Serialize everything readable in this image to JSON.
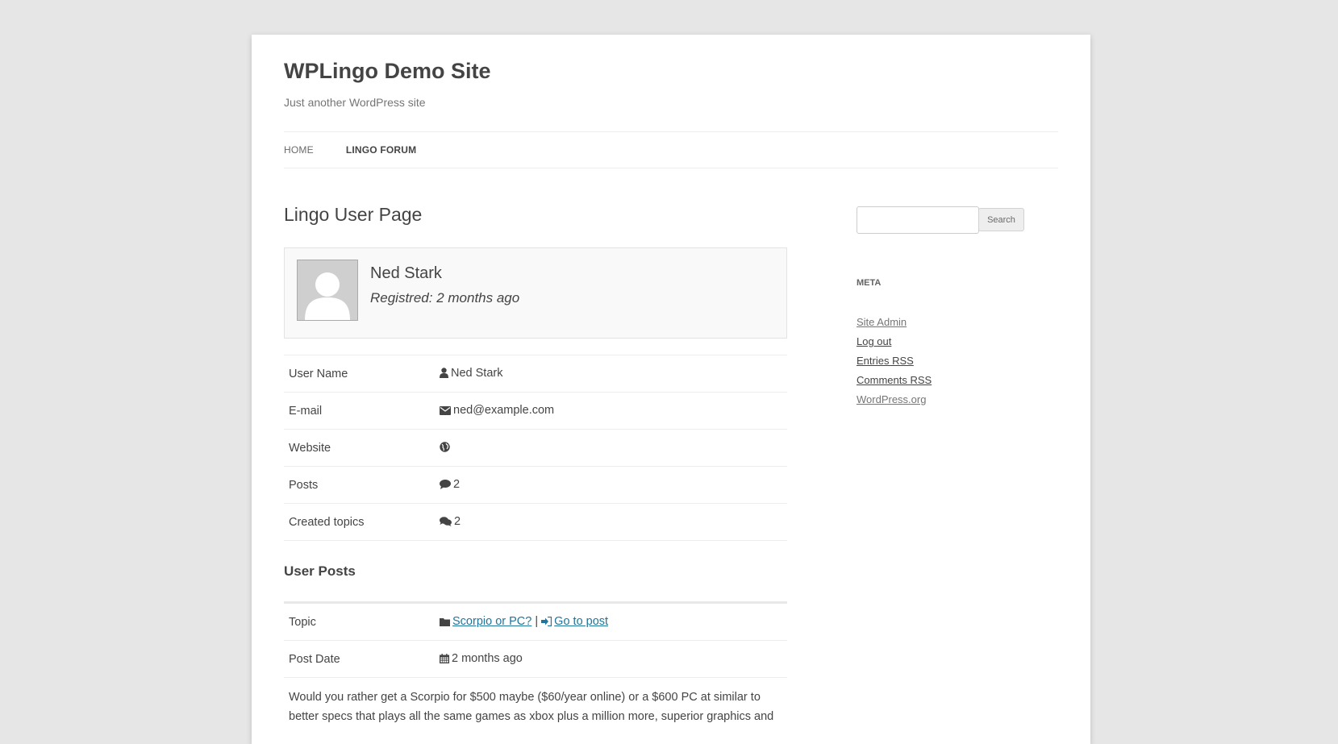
{
  "site": {
    "title": "WPLingo Demo Site",
    "description": "Just another WordPress site"
  },
  "nav": [
    {
      "label": "Home",
      "current": false
    },
    {
      "label": "Lingo Forum",
      "current": true
    }
  ],
  "page": {
    "title": "Lingo User Page"
  },
  "profile": {
    "name": "Ned Stark",
    "registered": "Registred: 2 months ago"
  },
  "info": {
    "username_label": "User Name",
    "username_value": "Ned Stark",
    "email_label": "E-mail",
    "email_value": "ned@example.com",
    "website_label": "Website",
    "website_value": "",
    "posts_label": "Posts",
    "posts_value": "2",
    "topics_label": "Created topics",
    "topics_value": "2"
  },
  "user_posts": {
    "title": "User Posts",
    "topic_label": "Topic",
    "topic_link": "Scorpio or PC?",
    "separator": "|",
    "goto_link": "Go to post",
    "date_label": "Post Date",
    "date_value": "2 months ago",
    "body": "Would you rather get a Scorpio for $500 maybe ($60/year online) or a $600 PC at similar to better specs that plays all the same games as xbox plus a million more, superior graphics and"
  },
  "sidebar": {
    "search_placeholder": "",
    "search_button": "Search",
    "meta_title": "Meta",
    "meta_links": [
      "Site Admin",
      "Log out",
      "Entries RSS",
      "Comments RSS",
      "WordPress.org"
    ]
  },
  "icons": {
    "user": "user-icon",
    "email": "envelope-icon",
    "website": "globe-icon",
    "posts": "comment-icon",
    "topics": "comments-icon",
    "folder": "folder-icon",
    "goto": "sign-in-icon",
    "date": "calendar-icon",
    "avatar": "default-avatar-icon"
  },
  "colors": {
    "background": "#e6e6e6",
    "link": "#21759b",
    "text": "#444444"
  }
}
